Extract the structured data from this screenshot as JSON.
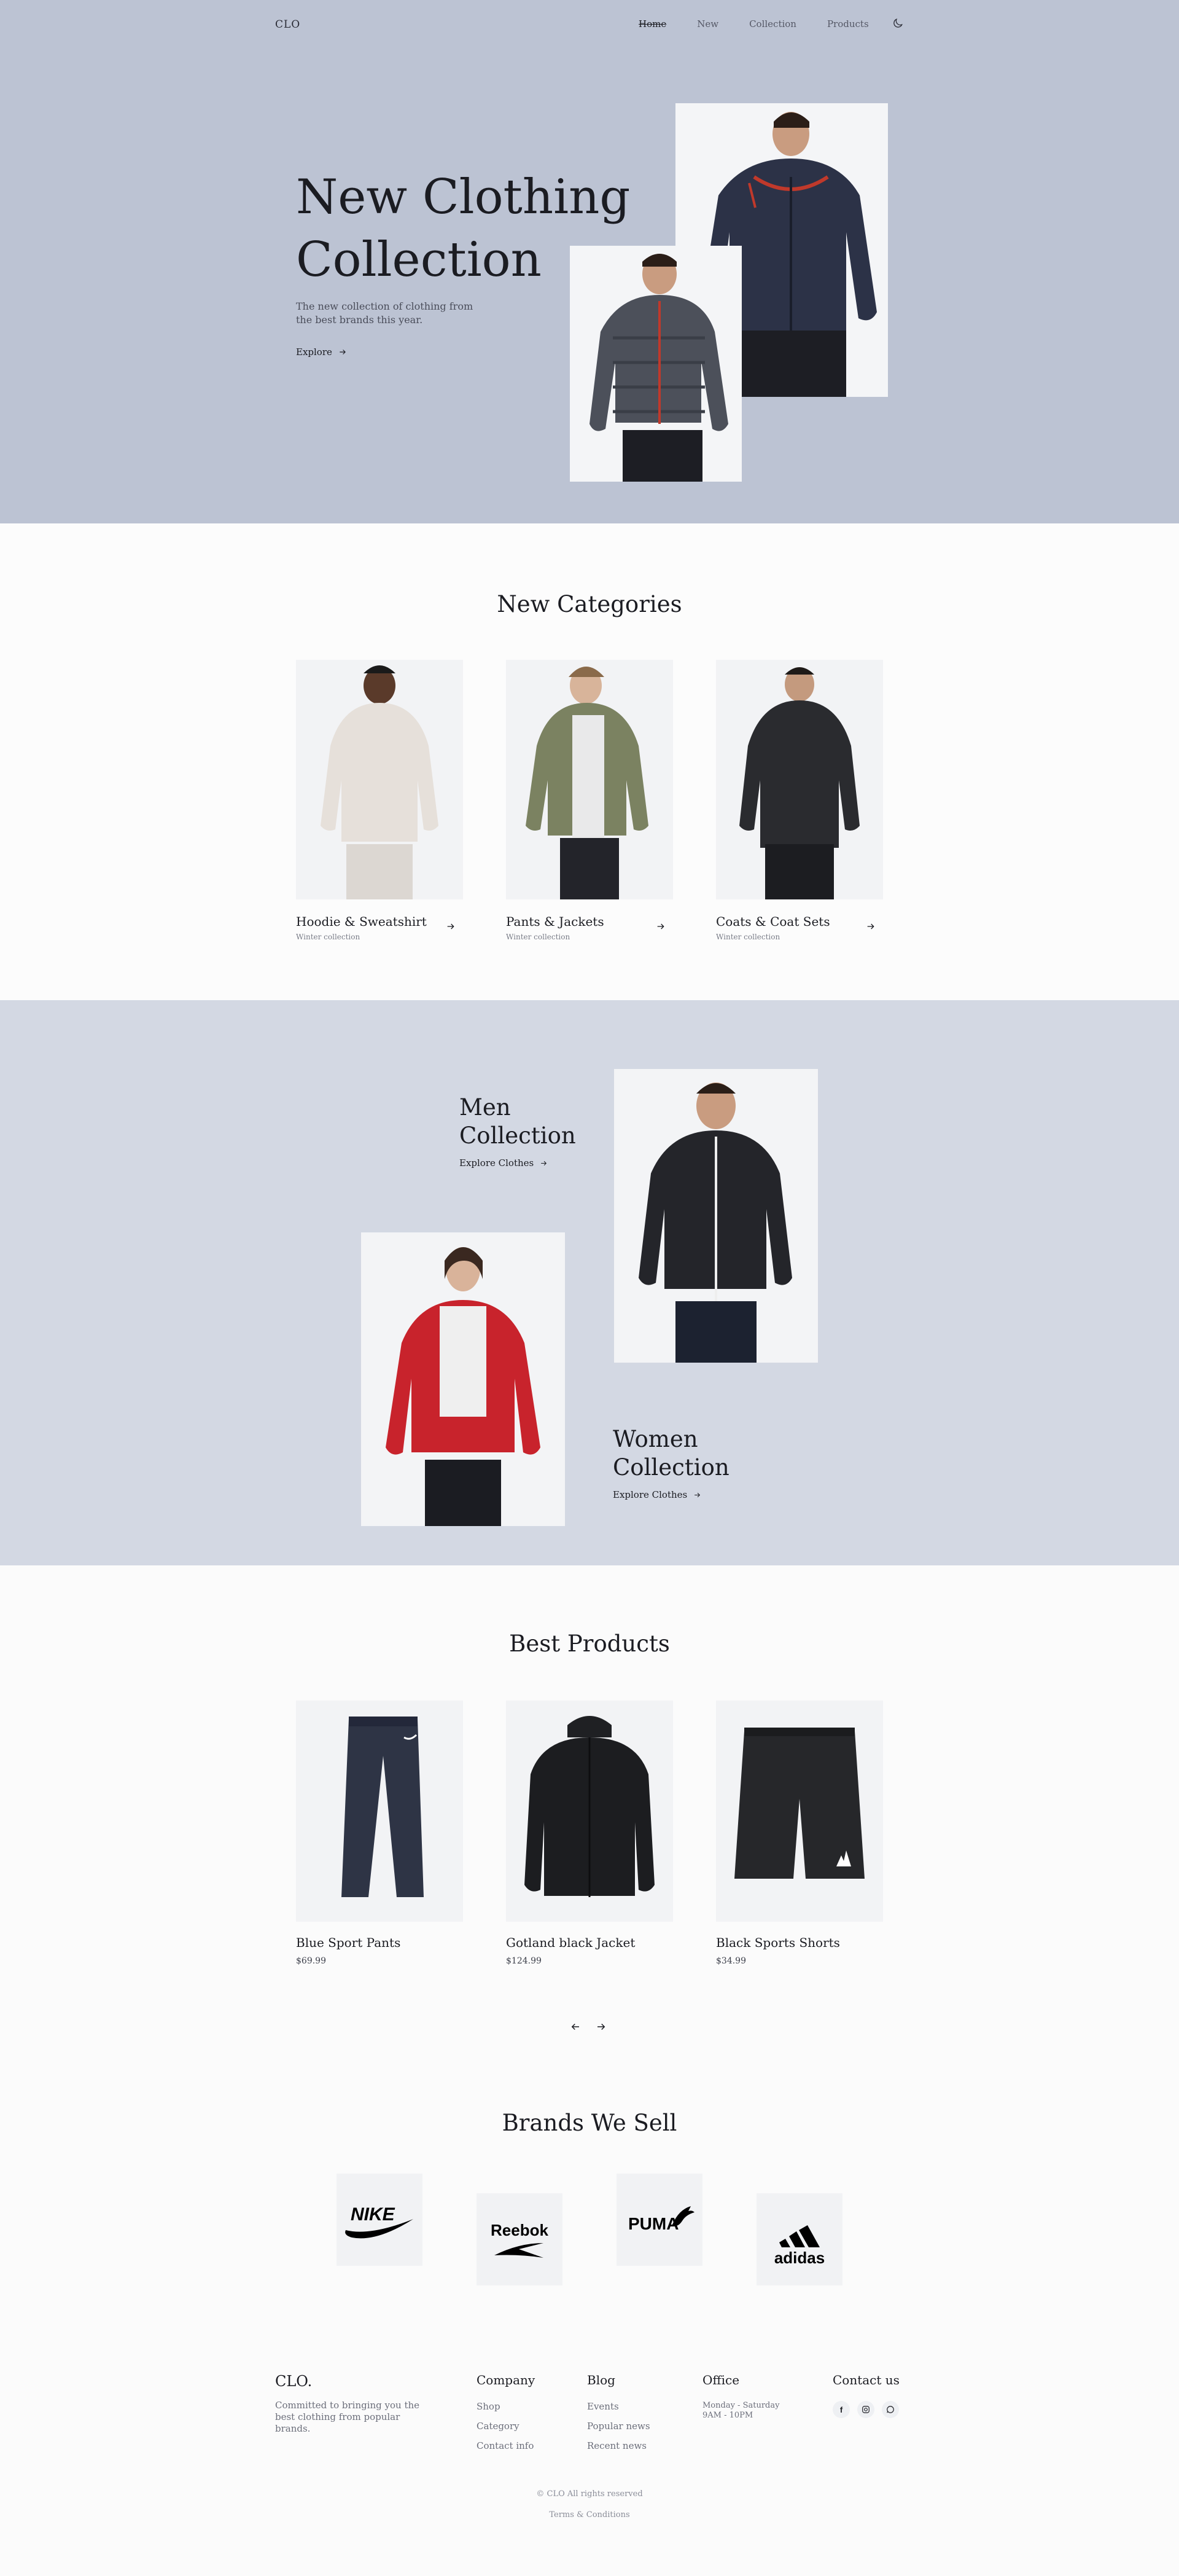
{
  "nav": {
    "logo": "CLO",
    "links": [
      "Home",
      "New",
      "Collection",
      "Products"
    ],
    "theme_icon": "moon-icon"
  },
  "hero": {
    "title": "New Clothing Collection",
    "description": "The new collection of clothing from the best brands this year.",
    "cta": "Explore"
  },
  "categories": {
    "title": "New Categories",
    "items": [
      {
        "name": "Hoodie & Sweatshirt",
        "sub": "Winter collection"
      },
      {
        "name": "Pants & Jackets",
        "sub": "Winter collection"
      },
      {
        "name": "Coats & Coat Sets",
        "sub": "Winter collection"
      }
    ]
  },
  "collections": {
    "men": {
      "title": "Men Collection",
      "link": "Explore Clothes"
    },
    "women": {
      "title": "Women Collection",
      "link": "Explore Clothes"
    }
  },
  "products": {
    "title": "Best Products",
    "items": [
      {
        "name": "Blue Sport Pants",
        "price": "$69.99"
      },
      {
        "name": "Gotland black Jacket",
        "price": "$124.99"
      },
      {
        "name": "Black Sports Shorts",
        "price": "$34.99"
      }
    ]
  },
  "brands": {
    "title": "Brands We Sell",
    "items": [
      "NIKE",
      "Reebok",
      "PUMA",
      "adidas"
    ]
  },
  "footer": {
    "logo": "CLO.",
    "description": "Committed to bringing you the best clothing from popular brands.",
    "company": {
      "title": "Company",
      "links": [
        "Shop",
        "Category",
        "Contact info"
      ]
    },
    "blog": {
      "title": "Blog",
      "links": [
        "Events",
        "Popular news",
        "Recent news"
      ]
    },
    "office": {
      "title": "Office",
      "hours": "Monday - Saturday 9AM - 10PM"
    },
    "contact": {
      "title": "Contact us",
      "socials": [
        "facebook-icon",
        "instagram-icon",
        "whatsapp-icon"
      ]
    },
    "copyright": "© CLO All rights reserved",
    "terms": "Terms & Conditions"
  }
}
